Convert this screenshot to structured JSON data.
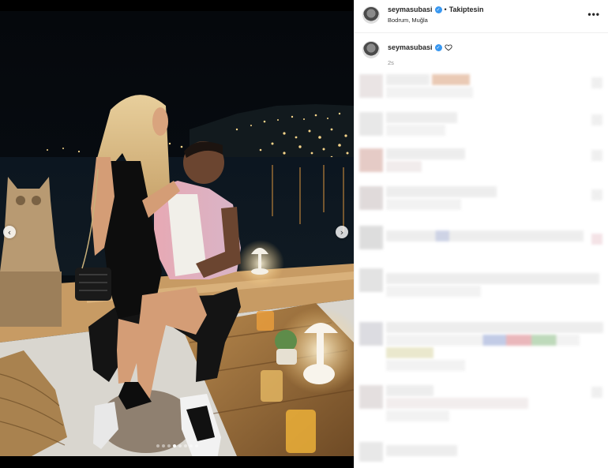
{
  "post": {
    "username": "seymasubasi",
    "separator": "•",
    "follow_status": "Takiptesin",
    "location": "Bodrum, Muğla",
    "more": "•••",
    "caption_username": "seymasubasi",
    "timestamp": "2s"
  },
  "carousel": {
    "prev": "‹",
    "next": "›",
    "dot_count": 8,
    "active_dot": 3
  },
  "colors": {
    "verified": "#3897f0",
    "panel_bg": "#ffffff",
    "media_bg": "#000000"
  }
}
